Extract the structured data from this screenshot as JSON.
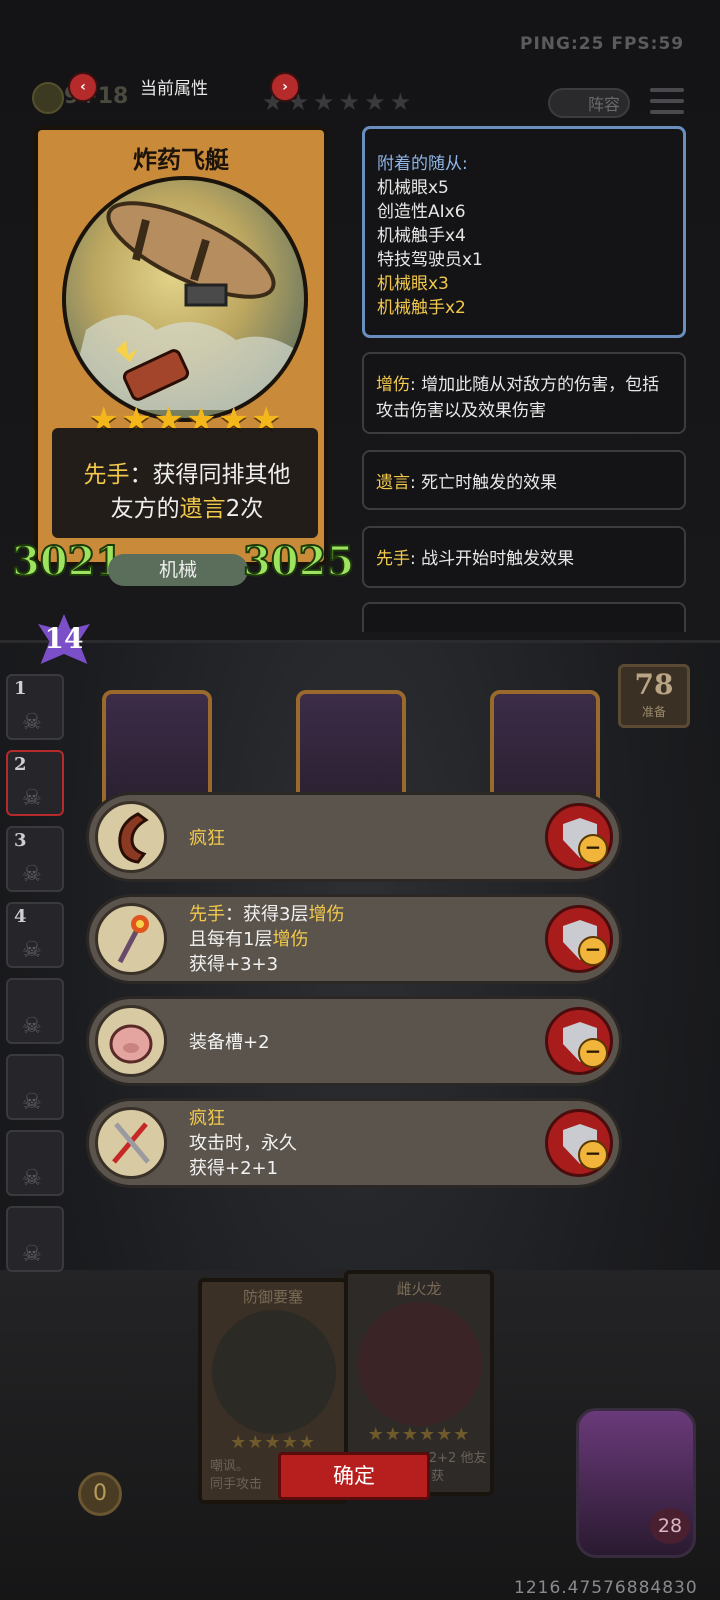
{
  "hud": {
    "ping_fps": "PING:25   FPS:59",
    "coins": "9+18",
    "lineup_label": "阵容"
  },
  "tab": {
    "title": "当前属性",
    "prev_icon": "chevron-left-icon",
    "next_icon": "chevron-right-icon"
  },
  "card": {
    "name": "炸药飞艇",
    "stars": "★★★★★★",
    "desc_prefix": "先手",
    "desc_part1": "：获得同排其他",
    "desc_part2": "友方的",
    "desc_keyword": "遗言",
    "desc_part3": "2次",
    "attack": "3021",
    "health": "3025",
    "tribe": "机械",
    "level": "14"
  },
  "attached_minions": {
    "title": "附着的随从:",
    "items": [
      {
        "text": "机械眼x5",
        "highlight": false
      },
      {
        "text": "创造性AIx6",
        "highlight": false
      },
      {
        "text": "机械触手x4",
        "highlight": false
      },
      {
        "text": "特技驾驶员x1",
        "highlight": false
      },
      {
        "text": "机械眼x3",
        "highlight": true
      },
      {
        "text": "机械触手x2",
        "highlight": true
      }
    ]
  },
  "keywords": [
    {
      "name": "增伤",
      "desc": ": 增加此随从对敌方的伤害，包括攻击伤害以及效果伤害"
    },
    {
      "name": "遗言",
      "desc": ": 死亡时触发的效果"
    },
    {
      "name": "先手",
      "desc": ": 战斗开始时触发效果"
    }
  ],
  "slots": [
    "1",
    "2",
    "3",
    "4"
  ],
  "ready": {
    "count": "78",
    "label": "准备"
  },
  "buffs": [
    {
      "icon": "horn-icon",
      "lines": [
        {
          "parts": [
            {
              "t": "疯狂",
              "gold": true
            }
          ]
        }
      ]
    },
    {
      "icon": "torch-icon",
      "lines": [
        {
          "parts": [
            {
              "t": "先手",
              "gold": true
            },
            {
              "t": "：获得3层",
              "gold": false
            },
            {
              "t": "增伤",
              "gold": true
            }
          ]
        },
        {
          "parts": [
            {
              "t": "且每有1层",
              "gold": false
            },
            {
              "t": "增伤",
              "gold": true
            }
          ]
        },
        {
          "parts": [
            {
              "t": "获得+3+3",
              "gold": false
            }
          ]
        }
      ]
    },
    {
      "icon": "pig-icon",
      "lines": [
        {
          "parts": [
            {
              "t": "装备槽+2",
              "gold": false
            }
          ]
        }
      ]
    },
    {
      "icon": "crossed-swords-icon",
      "lines": [
        {
          "parts": [
            {
              "t": "疯狂",
              "gold": true
            }
          ]
        },
        {
          "parts": [
            {
              "t": "攻击时，永久",
              "gold": false
            }
          ]
        },
        {
          "parts": [
            {
              "t": "获得+2+1",
              "gold": false
            }
          ]
        }
      ]
    }
  ],
  "picks": [
    {
      "name": "防御要塞",
      "desc": "嘲讽。\n同手攻击"
    },
    {
      "name": "雌火龙",
      "desc": "+2+2\n他友方获"
    }
  ],
  "confirm_label": "确定",
  "gold": "0",
  "hero_hp": "28",
  "coords": "1216.47576884830",
  "colors": {
    "gold": "#f2c94c",
    "stat_green": "#9ee35f",
    "confirm_red": "#b71e1e"
  }
}
